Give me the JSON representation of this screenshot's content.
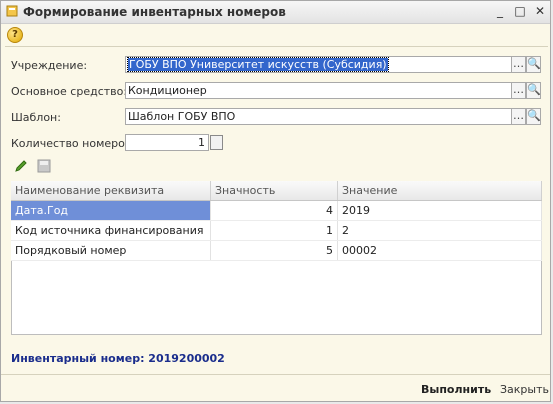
{
  "window": {
    "title": "Формирование инвентарных номеров"
  },
  "form": {
    "institution": {
      "label": "Учреждение:",
      "value": "ГОБУ ВПО Университет искусств (Субсидия)"
    },
    "asset": {
      "label": "Основное средство:",
      "value": "Кондиционер"
    },
    "template": {
      "label": "Шаблон:",
      "value": "Шаблон ГОБУ ВПО"
    },
    "count": {
      "label": "Количество номеров:",
      "value": "1"
    }
  },
  "table": {
    "columns": [
      "Наименование реквизита",
      "Значность",
      "Значение"
    ],
    "rows": [
      {
        "name": "Дата.Год",
        "digits": "4",
        "value": "2019"
      },
      {
        "name": "Код источника финансирования",
        "digits": "1",
        "value": "2"
      },
      {
        "name": "Порядковый номер",
        "digits": "5",
        "value": "00002"
      }
    ]
  },
  "inventory_number": "Инвентарный номер: 2019200002",
  "buttons": {
    "run": "Выполнить",
    "close": "Закрыть"
  },
  "colors": {
    "accent": "#1a2d8c",
    "selection": "#3366cc"
  }
}
